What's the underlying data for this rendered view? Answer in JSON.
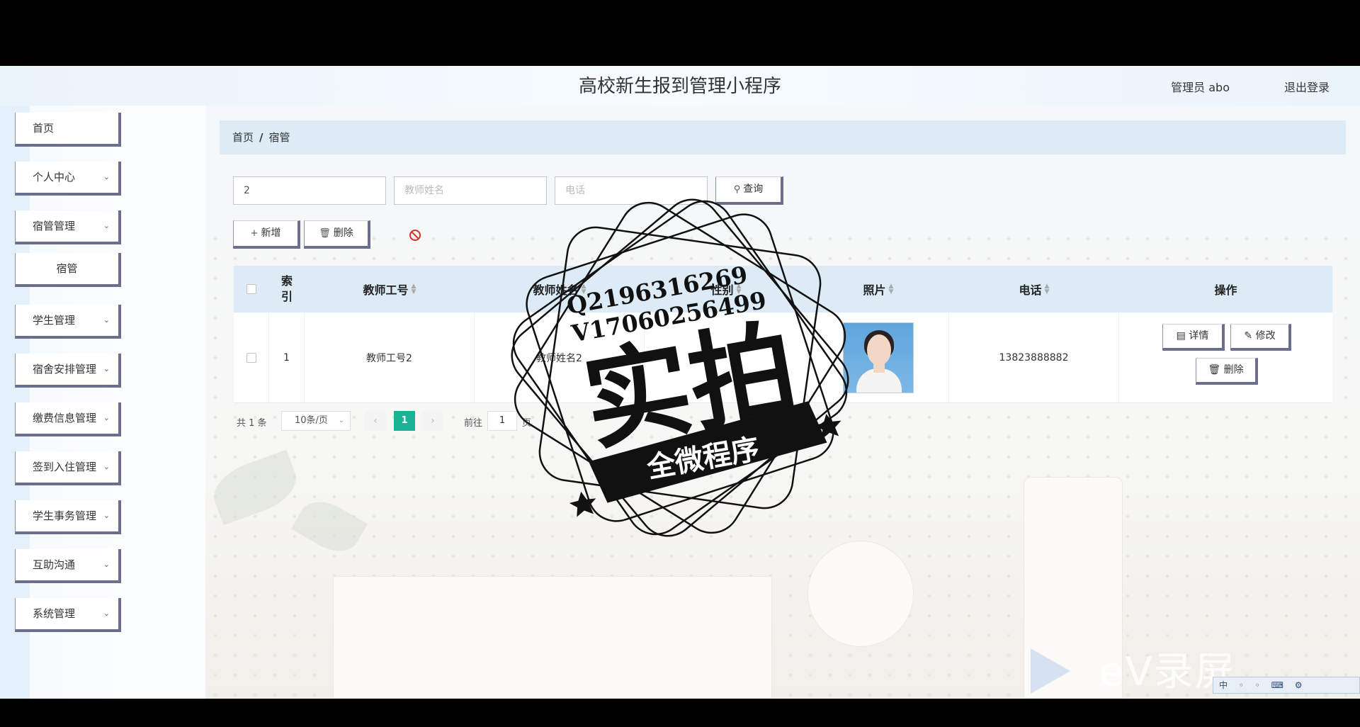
{
  "app": {
    "title": "高校新生报到管理小程序",
    "user_label": "管理员 abo",
    "logout_label": "退出登录"
  },
  "sidebar": {
    "items": [
      {
        "label": "首页",
        "has_children": false
      },
      {
        "label": "个人中心",
        "has_children": true
      },
      {
        "label": "宿管管理",
        "has_children": true
      },
      {
        "label": "宿管",
        "sub": true
      },
      {
        "label": "学生管理",
        "has_children": true
      },
      {
        "label": "宿舍安排管理",
        "has_children": true
      },
      {
        "label": "缴费信息管理",
        "has_children": true
      },
      {
        "label": "签到入住管理",
        "has_children": true
      },
      {
        "label": "学生事务管理",
        "has_children": true
      },
      {
        "label": "互助沟通",
        "has_children": true
      },
      {
        "label": "系统管理",
        "has_children": true
      }
    ],
    "chevron_icon": "chevron-down-icon"
  },
  "breadcrumb": {
    "home": "首页",
    "separator": "/",
    "current": "宿管"
  },
  "search": {
    "teacher_id_value": "2",
    "teacher_name_placeholder": "教师姓名",
    "phone_placeholder": "电话",
    "query_label": "查询"
  },
  "toolbar": {
    "add_label": "新增",
    "delete_label": "删除"
  },
  "table": {
    "columns": [
      "索引",
      "教师工号",
      "教师姓名",
      "性别",
      "照片",
      "电话",
      "操作"
    ],
    "rows": [
      {
        "index": "1",
        "teacher_id": "教师工号2",
        "teacher_name": "教师姓名2",
        "gender": "",
        "phone": "13823888882"
      }
    ],
    "actions": {
      "detail_label": "详情",
      "edit_label": "修改",
      "delete_label": "删除"
    }
  },
  "pagination": {
    "total_text": "共 1 条",
    "page_size": "10条/页",
    "current_page": "1",
    "goto_prefix": "前往",
    "goto_value": "1",
    "goto_suffix": "页"
  },
  "overlay": {
    "stamp_line1": "Q2196316269",
    "stamp_line2": "V17060256499",
    "stamp_main": "实拍",
    "stamp_banner": "全微程序",
    "watermark": "eV录屏",
    "tray_text": "中 ◦ ◦ ⌨ ⚙"
  },
  "colors": {
    "accent_green": "#19b393",
    "header_blue": "#dcebf6",
    "button_border": "#6b6f8d",
    "danger_red": "#d4302b"
  }
}
